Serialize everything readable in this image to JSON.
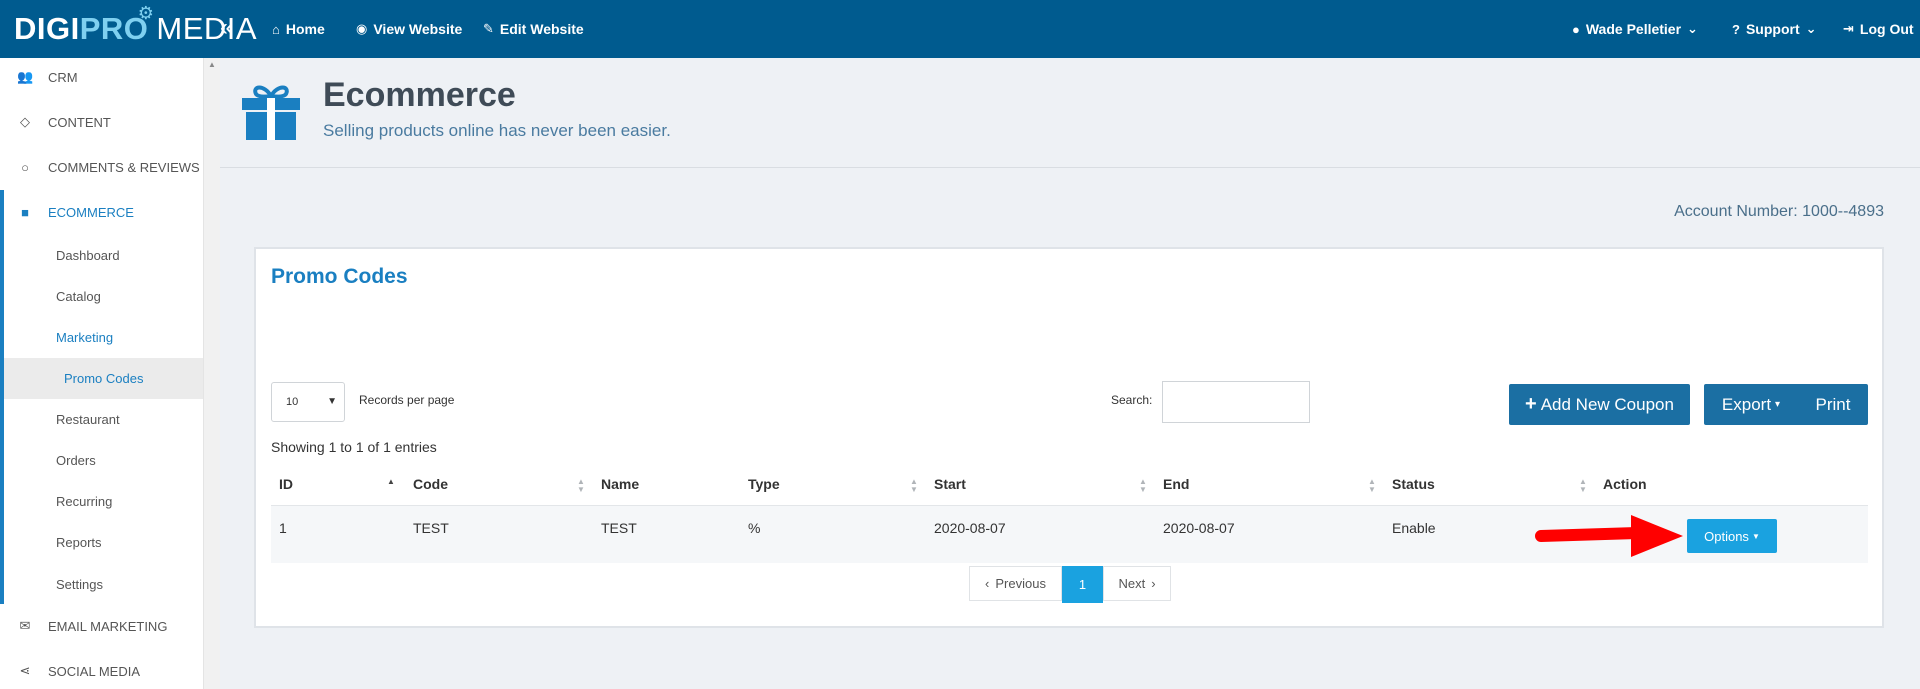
{
  "header": {
    "logo": {
      "digi": "DIGI",
      "pro": "PRO",
      "media": "MEDIA"
    },
    "collapse_icon": "«",
    "nav": [
      {
        "label": "Home",
        "icon": "home-icon"
      },
      {
        "label": "View Website",
        "icon": "eye-icon"
      },
      {
        "label": "Edit Website",
        "icon": "edit-icon"
      }
    ],
    "user": {
      "label": "Wade Pelletier",
      "icon": "user-circle-icon"
    },
    "support": {
      "label": "Support",
      "icon": "question-circle-icon"
    },
    "logout": {
      "label": "Log Out",
      "icon": "sign-out-icon"
    }
  },
  "sidebar": {
    "items": [
      {
        "label": "CRM",
        "icon": "users-icon"
      },
      {
        "label": "CONTENT",
        "icon": "diamond-icon"
      },
      {
        "label": "COMMENTS & REVIEWS",
        "icon": "comment-icon"
      },
      {
        "label": "ECOMMERCE",
        "icon": "gift-icon"
      },
      {
        "label": "EMAIL MARKETING",
        "icon": "envelope-icon"
      },
      {
        "label": "SOCIAL MEDIA",
        "icon": "share-icon"
      }
    ],
    "ecommerce_sub": [
      "Dashboard",
      "Catalog",
      "Marketing",
      "Restaurant",
      "Orders",
      "Recurring",
      "Reports",
      "Settings"
    ],
    "marketing_sub": "Promo Codes"
  },
  "page": {
    "title": "Ecommerce",
    "subtitle": "Selling products online has never been easier.",
    "account_number": "Account Number: 1000--4893"
  },
  "panel": {
    "title": "Promo Codes",
    "records_per_page_value": "10",
    "records_per_page_label": "Records per page",
    "search_label": "Search:",
    "search_value": "",
    "add_button": "Add New Coupon",
    "export_button": "Export",
    "print_button": "Print",
    "showing_text": "Showing 1 to 1 of 1 entries",
    "columns": [
      "ID",
      "Code",
      "Name",
      "Type",
      "Start",
      "End",
      "Status",
      "Action"
    ],
    "rows": [
      {
        "id": "1",
        "code": "TEST",
        "name": "TEST",
        "type": "%",
        "start": "2020-08-07",
        "end": "2020-08-07",
        "status": "Enable",
        "action": "Options"
      }
    ],
    "pagination": {
      "previous": "Previous",
      "current": "1",
      "next": "Next"
    }
  },
  "colors": {
    "topbar": "#005b8f",
    "accent": "#1a7fc1",
    "button_primary": "#1b6fa3",
    "button_options": "#1aa2e0",
    "arrow": "#ff0000"
  }
}
